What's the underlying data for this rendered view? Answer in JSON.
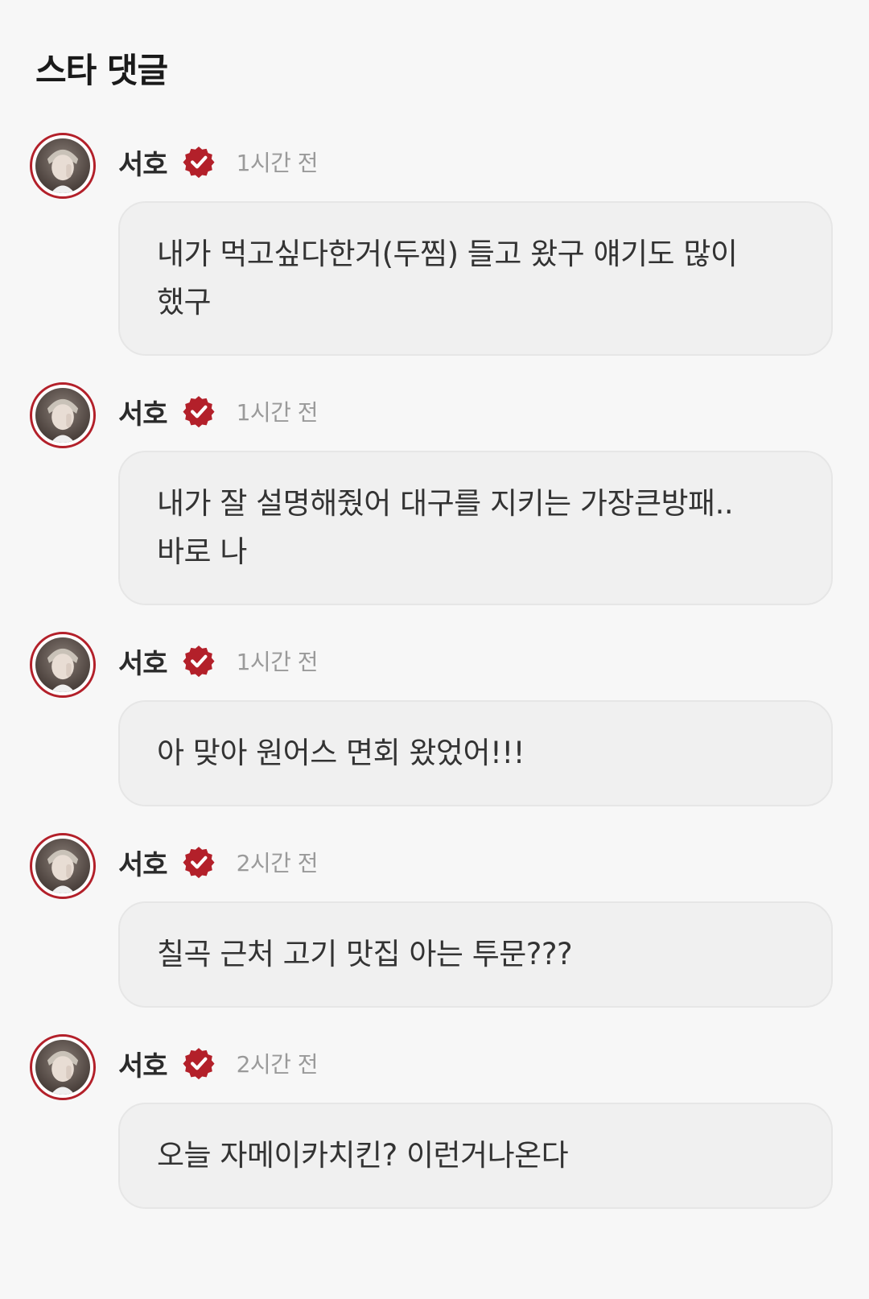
{
  "section_title": "스타 댓글",
  "colors": {
    "background": "#f7f7f7",
    "bubble": "#f0f0f0",
    "accent": "#b3202a",
    "timestamp": "#9a9a9a"
  },
  "comments": [
    {
      "author": "서호",
      "verified_icon": "verified-badge-icon",
      "time": "1시간 전",
      "text": "내가 먹고싶다한거(두찜) 들고 왔구 얘기도 많이 했구"
    },
    {
      "author": "서호",
      "verified_icon": "verified-badge-icon",
      "time": "1시간 전",
      "text": "내가 잘 설명해줬어 대구를 지키는 가장큰방패.. 바로 나"
    },
    {
      "author": "서호",
      "verified_icon": "verified-badge-icon",
      "time": "1시간 전",
      "text": "아 맞아 원어스 면회 왔었어!!!"
    },
    {
      "author": "서호",
      "verified_icon": "verified-badge-icon",
      "time": "2시간 전",
      "text": "칠곡 근처 고기 맛집 아는 투문???"
    },
    {
      "author": "서호",
      "verified_icon": "verified-badge-icon",
      "time": "2시간 전",
      "text": "오늘 자메이카치킨? 이런거나온다"
    }
  ]
}
